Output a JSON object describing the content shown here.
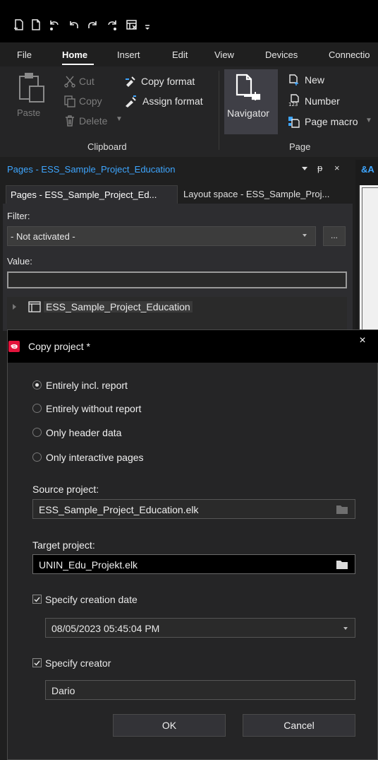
{
  "menu": {
    "tabs": [
      "File",
      "Home",
      "Insert",
      "Edit",
      "View",
      "Devices",
      "Connectio"
    ],
    "active": "Home"
  },
  "ribbon": {
    "clipboard": {
      "paste": "Paste",
      "cut": "Cut",
      "copy": "Copy",
      "delete": "Delete",
      "copy_format": "Copy format",
      "assign_format": "Assign format",
      "group_label": "Clipboard"
    },
    "page": {
      "navigator": "Navigator",
      "new": "New",
      "number": "Number",
      "page_macro": "Page macro",
      "group_label": "Page"
    }
  },
  "pages_panel": {
    "title": "Pages - ESS_Sample_Project_Education",
    "right_tab": "&A",
    "tabs": [
      "Pages - ESS_Sample_Project_Ed...",
      "Layout space - ESS_Sample_Proj..."
    ],
    "filter_label": "Filter:",
    "filter_value": "- Not activated -",
    "filter_more": "...",
    "value_label": "Value:",
    "tree_root": "ESS_Sample_Project_Education"
  },
  "dialog": {
    "title": "Copy project *",
    "close": "×",
    "options": [
      {
        "label": "Entirely incl. report",
        "checked": true
      },
      {
        "label": "Entirely without report",
        "checked": false
      },
      {
        "label": "Only header data",
        "checked": false
      },
      {
        "label": "Only interactive pages",
        "checked": false
      }
    ],
    "source_label": "Source project:",
    "source_value": "ESS_Sample_Project_Education.elk",
    "target_label": "Target project:",
    "target_value": "UNIN_Edu_Projekt.elk",
    "creation_date_label": "Specify creation date",
    "creation_date_checked": true,
    "creation_date_value": "08/05/2023 05:45:04 PM",
    "creator_label": "Specify creator",
    "creator_checked": true,
    "creator_value": "Dario",
    "ok": "OK",
    "cancel": "Cancel"
  },
  "colors": {
    "accent_blue": "#3ea6ff",
    "brand_red": "#e3143c"
  }
}
